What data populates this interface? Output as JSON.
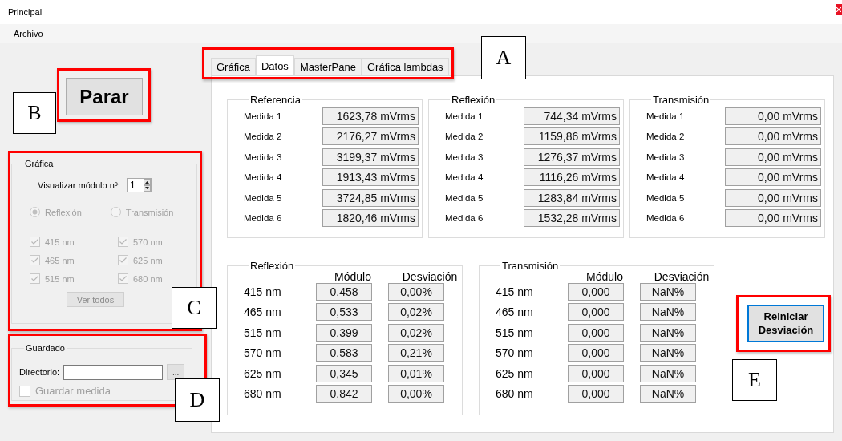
{
  "window": {
    "title": "Principal"
  },
  "menu": [
    {
      "label": "Archivo"
    }
  ],
  "stop_button": {
    "label": "Parar",
    "annotation": "B"
  },
  "graph_group": {
    "title": "Gráfica",
    "annotation": "C",
    "module_label": "Visualizar módulo nº:",
    "module_value": "1",
    "radios": [
      {
        "label": "Reflexión",
        "selected": true,
        "disabled": true
      },
      {
        "label": "Transmisión",
        "selected": false,
        "disabled": true
      }
    ],
    "checkboxes": [
      {
        "label": "415 nm",
        "checked": true,
        "disabled": true
      },
      {
        "label": "570 nm",
        "checked": true,
        "disabled": true
      },
      {
        "label": "465 nm",
        "checked": true,
        "disabled": true
      },
      {
        "label": "625 nm",
        "checked": true,
        "disabled": true
      },
      {
        "label": "515 nm",
        "checked": true,
        "disabled": true
      },
      {
        "label": "680 nm",
        "checked": true,
        "disabled": true
      }
    ],
    "show_all_button": {
      "label": "Ver todos",
      "disabled": true
    }
  },
  "save_group": {
    "title": "Guardado",
    "annotation": "D",
    "directory_label": "Directorio:",
    "browse_button": "...",
    "save_checkbox": {
      "label": "Guardar medida",
      "checked": false,
      "disabled": true
    }
  },
  "tabs": {
    "annotation": "A",
    "items": [
      {
        "label": "Gráfica",
        "selected": false
      },
      {
        "label": "Datos",
        "selected": true
      },
      {
        "label": "MasterPane",
        "selected": false
      },
      {
        "label": "Gráfica lambdas",
        "selected": false
      }
    ]
  },
  "measure_groups": [
    {
      "title": "Referencia",
      "rows": [
        {
          "label": "Medida 1",
          "value": "1623,78 mVrms"
        },
        {
          "label": "Medida 2",
          "value": "2176,27 mVrms"
        },
        {
          "label": "Medida 3",
          "value": "3199,37 mVrms"
        },
        {
          "label": "Medida 4",
          "value": "1913,43 mVrms"
        },
        {
          "label": "Medida 5",
          "value": "3724,85 mVrms"
        },
        {
          "label": "Medida 6",
          "value": "1820,46 mVrms"
        }
      ]
    },
    {
      "title": "Reflexión",
      "rows": [
        {
          "label": "Medida 1",
          "value": "744,34 mVrms"
        },
        {
          "label": "Medida 2",
          "value": "1159,86 mVrms"
        },
        {
          "label": "Medida 3",
          "value": "1276,37 mVrms"
        },
        {
          "label": "Medida 4",
          "value": "1116,26 mVrms"
        },
        {
          "label": "Medida 5",
          "value": "1283,84 mVrms"
        },
        {
          "label": "Medida 6",
          "value": "1532,28 mVrms"
        }
      ]
    },
    {
      "title": "Transmisión",
      "rows": [
        {
          "label": "Medida 1",
          "value": "0,00 mVrms"
        },
        {
          "label": "Medida 2",
          "value": "0,00 mVrms"
        },
        {
          "label": "Medida 3",
          "value": "0,00 mVrms"
        },
        {
          "label": "Medida 4",
          "value": "0,00 mVrms"
        },
        {
          "label": "Medida 5",
          "value": "0,00 mVrms"
        },
        {
          "label": "Medida 6",
          "value": "0,00 mVrms"
        }
      ]
    }
  ],
  "module_groups": [
    {
      "title": "Reflexión",
      "columns": [
        "Módulo",
        "Desviación"
      ],
      "rows": [
        {
          "label": "415 nm",
          "module": "0,458",
          "deviation": "0,00%"
        },
        {
          "label": "465 nm",
          "module": "0,533",
          "deviation": "0,02%"
        },
        {
          "label": "515 nm",
          "module": "0,399",
          "deviation": "0,02%"
        },
        {
          "label": "570 nm",
          "module": "0,583",
          "deviation": "0,21%"
        },
        {
          "label": "625 nm",
          "module": "0,345",
          "deviation": "0,01%"
        },
        {
          "label": "680 nm",
          "module": "0,842",
          "deviation": "0,00%"
        }
      ]
    },
    {
      "title": "Transmisión",
      "columns": [
        "Módulo",
        "Desviación"
      ],
      "rows": [
        {
          "label": "415 nm",
          "module": "0,000",
          "deviation": "NaN%"
        },
        {
          "label": "465 nm",
          "module": "0,000",
          "deviation": "NaN%"
        },
        {
          "label": "515 nm",
          "module": "0,000",
          "deviation": "NaN%"
        },
        {
          "label": "570 nm",
          "module": "0,000",
          "deviation": "NaN%"
        },
        {
          "label": "625 nm",
          "module": "0,000",
          "deviation": "NaN%"
        },
        {
          "label": "680 nm",
          "module": "0,000",
          "deviation": "NaN%"
        }
      ]
    }
  ],
  "reset_button": {
    "label": "Reiniciar Desviación",
    "annotation": "E"
  }
}
